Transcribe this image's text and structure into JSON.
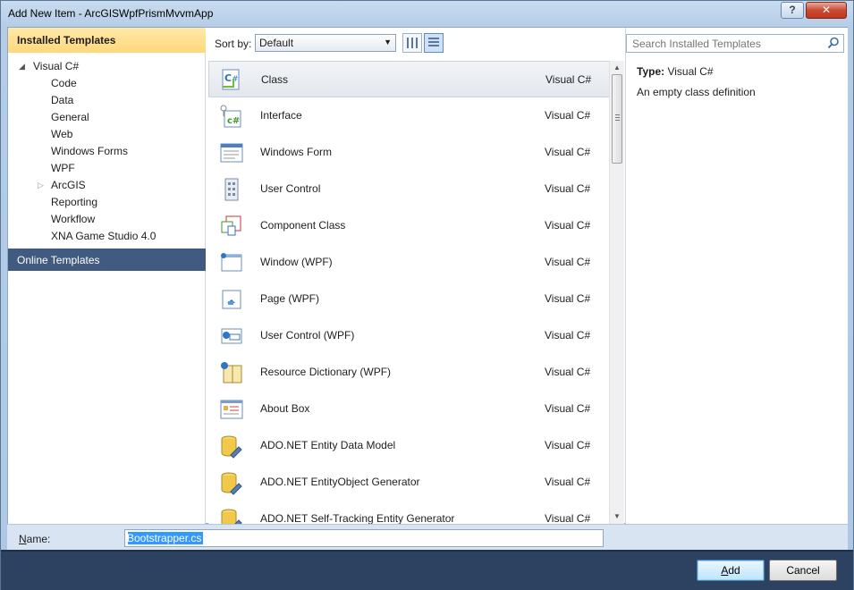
{
  "window": {
    "title": "Add New Item - ArcGISWpfPrismMvvmApp",
    "help_label": "?",
    "close_label": "✕"
  },
  "left_pane": {
    "installed_header": "Installed Templates",
    "tree": [
      {
        "label": "Visual C#",
        "level": 0,
        "expander": "◢"
      },
      {
        "label": "Code",
        "level": 1
      },
      {
        "label": "Data",
        "level": 1
      },
      {
        "label": "General",
        "level": 1
      },
      {
        "label": "Web",
        "level": 1
      },
      {
        "label": "Windows Forms",
        "level": 1
      },
      {
        "label": "WPF",
        "level": 1
      },
      {
        "label": "ArcGIS",
        "level": 1,
        "expander": "▷"
      },
      {
        "label": "Reporting",
        "level": 1
      },
      {
        "label": "Workflow",
        "level": 1
      },
      {
        "label": "XNA Game Studio 4.0",
        "level": 1
      }
    ],
    "online_header": "Online Templates"
  },
  "toolbar": {
    "sort_label": "Sort by:",
    "sort_value": "Default"
  },
  "search": {
    "placeholder": "Search Installed Templates"
  },
  "templates": [
    {
      "name": "Class",
      "lang": "Visual C#",
      "icon": "class-icon"
    },
    {
      "name": "Interface",
      "lang": "Visual C#",
      "icon": "interface-icon"
    },
    {
      "name": "Windows Form",
      "lang": "Visual C#",
      "icon": "windows-form-icon"
    },
    {
      "name": "User Control",
      "lang": "Visual C#",
      "icon": "user-control-icon"
    },
    {
      "name": "Component Class",
      "lang": "Visual C#",
      "icon": "component-class-icon"
    },
    {
      "name": "Window (WPF)",
      "lang": "Visual C#",
      "icon": "wpf-window-icon"
    },
    {
      "name": "Page (WPF)",
      "lang": "Visual C#",
      "icon": "wpf-page-icon"
    },
    {
      "name": "User Control (WPF)",
      "lang": "Visual C#",
      "icon": "wpf-user-control-icon"
    },
    {
      "name": "Resource Dictionary (WPF)",
      "lang": "Visual C#",
      "icon": "resource-dictionary-icon"
    },
    {
      "name": "About Box",
      "lang": "Visual C#",
      "icon": "about-box-icon"
    },
    {
      "name": "ADO.NET Entity Data Model",
      "lang": "Visual C#",
      "icon": "database-icon"
    },
    {
      "name": "ADO.NET EntityObject Generator",
      "lang": "Visual C#",
      "icon": "database-icon"
    },
    {
      "name": "ADO.NET Self-Tracking Entity Generator",
      "lang": "Visual C#",
      "icon": "database-icon"
    }
  ],
  "details": {
    "type_label": "Type:",
    "type_value": "Visual C#",
    "description": "An empty class definition"
  },
  "name_field": {
    "label_first": "N",
    "label_rest": "ame:",
    "value": "Bootstrapper.cs"
  },
  "buttons": {
    "add_first": "A",
    "add_rest": "dd",
    "cancel": "Cancel"
  }
}
